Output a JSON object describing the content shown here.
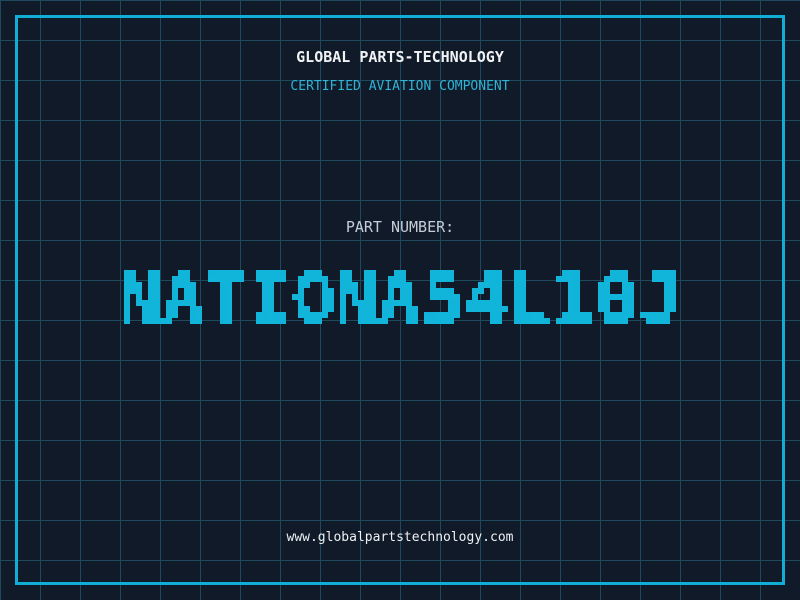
{
  "header": {
    "company": "GLOBAL PARTS-TECHNOLOGY",
    "tagline": "CERTIFIED AVIATION COMPONENT"
  },
  "part": {
    "label": "PART NUMBER:",
    "number": "NATIONA54L10J"
  },
  "footer": {
    "website": "www.globalpartstechnology.com"
  },
  "colors": {
    "background": "#101a28",
    "grid_line": "#1d4a5e",
    "frame_cyan": "#10aed6",
    "part_number_cyan": "#12b5da",
    "tagline_cyan": "#2fb3d6",
    "title_white": "#f0f2f4",
    "label_gray": "#c6cdd8"
  }
}
